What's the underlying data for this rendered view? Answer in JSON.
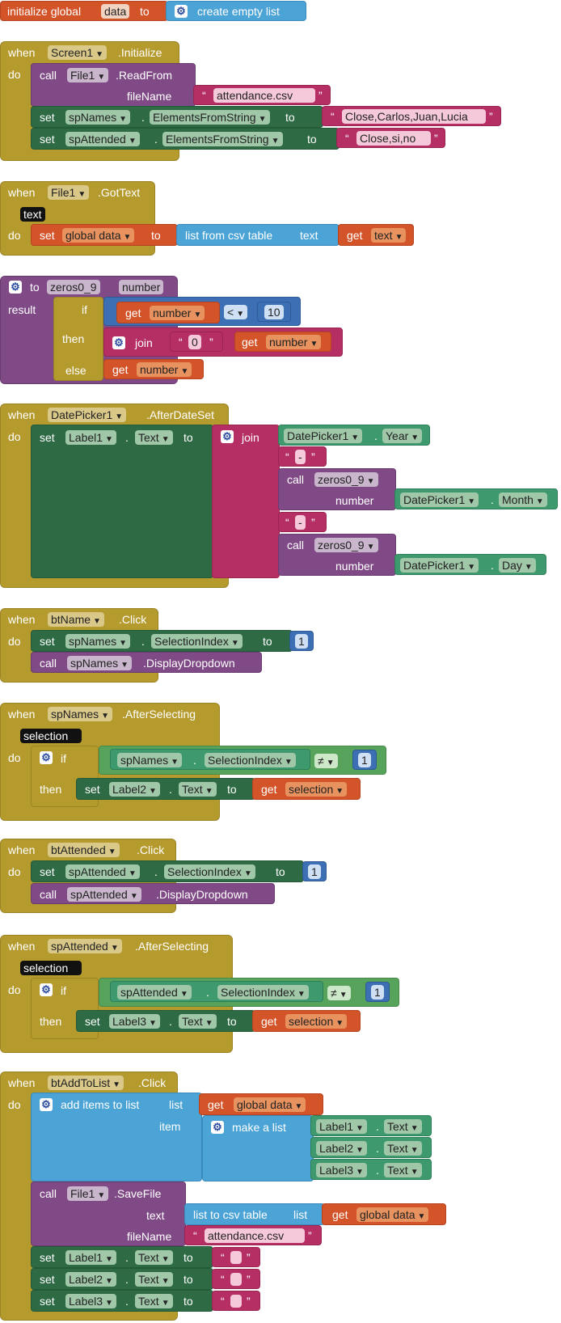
{
  "colors": {
    "control": "#b59a2e",
    "variable": "#d4542a",
    "procedure": "#7f4a86",
    "component": "#2e6b45",
    "text": "#b62f64",
    "list": "#4ba3d6",
    "logic_math": "#3f6fb7"
  },
  "kw": {
    "when": "when",
    "do": "do",
    "call": "call",
    "set": "set",
    "to": "to",
    "get": "get",
    "if": "if",
    "then": "then",
    "else": "else",
    "result": "result",
    "join": "join",
    "dot": ".",
    "quote_open": "“",
    "quote_close": "”",
    "number": "number",
    "text": "text",
    "list": "list",
    "item": "item",
    "fileName": "fileName"
  },
  "icons": {
    "gear": "⚙"
  },
  "b1": {
    "label": "initialize global",
    "name": "data",
    "to": "to",
    "value": "create empty list"
  },
  "b2": {
    "component": "Screen1",
    "event": ".Initialize",
    "call_component": "File1",
    "call_method": ".ReadFrom",
    "param": "fileName",
    "file": "attendance.csv",
    "set1_comp": "spNames",
    "set1_prop": "ElementsFromString",
    "set1_value": "Close,Carlos,Juan,Lucia",
    "set2_comp": "spAttended",
    "set2_prop": "ElementsFromString",
    "set2_value": "Close,si,no"
  },
  "b3": {
    "component": "File1",
    "event": ".GotText",
    "param": "text",
    "var": "global data",
    "fn": "list from csv table",
    "fn_param": "text",
    "get": "text"
  },
  "b4": {
    "proc": "zeros0_9",
    "param": "number",
    "op": "<",
    "n": "10",
    "zero": "0"
  },
  "b5": {
    "component": "DatePicker1",
    "event": ".AfterDateSet",
    "set_comp": "Label1",
    "set_prop": "Text",
    "year_comp": "DatePicker1",
    "year_prop": "Year",
    "dash": "-",
    "proc": "zeros0_9",
    "month_comp": "DatePicker1",
    "month_prop": "Month",
    "day_comp": "DatePicker1",
    "day_prop": "Day"
  },
  "b6": {
    "component": "btName",
    "event": ".Click",
    "set_comp": "spNames",
    "set_prop": "SelectionIndex",
    "value": "1",
    "call_comp": "spNames",
    "call_method": ".DisplayDropdown"
  },
  "b7": {
    "component": "spNames",
    "event": ".AfterSelecting",
    "param": "selection",
    "cmp_comp": "spNames",
    "cmp_prop": "SelectionIndex",
    "op": "≠",
    "value": "1",
    "set_comp": "Label2",
    "set_prop": "Text",
    "get": "selection"
  },
  "b8": {
    "component": "btAttended",
    "event": ".Click",
    "set_comp": "spAttended",
    "set_prop": "SelectionIndex",
    "value": "1",
    "call_comp": "spAttended",
    "call_method": ".DisplayDropdown"
  },
  "b9": {
    "component": "spAttended",
    "event": ".AfterSelecting",
    "param": "selection",
    "cmp_comp": "spAttended",
    "cmp_prop": "SelectionIndex",
    "op": "≠",
    "value": "1",
    "set_comp": "Label3",
    "set_prop": "Text",
    "get": "selection"
  },
  "b10": {
    "component": "btAddToList",
    "event": ".Click",
    "add_label": "add items to list",
    "list_var": "global data",
    "make_list": "make a list",
    "l1": "Label1",
    "l2": "Label2",
    "l3": "Label3",
    "prop": "Text",
    "save_comp": "File1",
    "save_method": ".SaveFile",
    "csv_fn": "list to csv table",
    "csv_var": "global data",
    "file": "attendance.csv"
  }
}
